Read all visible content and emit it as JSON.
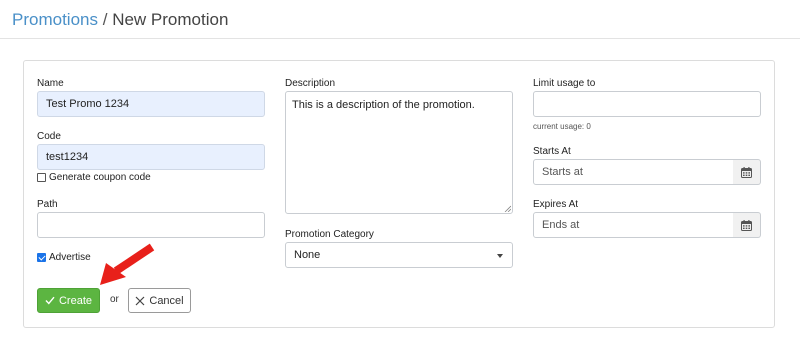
{
  "breadcrumb": {
    "parent": "Promotions",
    "separator": "/",
    "current": "New Promotion"
  },
  "form": {
    "name": {
      "label": "Name",
      "value": "Test Promo 1234"
    },
    "code": {
      "label": "Code",
      "value": "test1234"
    },
    "generate_coupon": {
      "label": "Generate coupon code",
      "checked": false
    },
    "path": {
      "label": "Path",
      "value": ""
    },
    "advertise": {
      "label": "Advertise",
      "checked": true
    },
    "description": {
      "label": "Description",
      "value": "This is a description of the promotion."
    },
    "promotion_category": {
      "label": "Promotion Category",
      "selected": "None"
    },
    "limit_usage": {
      "label": "Limit usage to",
      "value": "",
      "help": "current usage: 0"
    },
    "starts_at": {
      "label": "Starts At",
      "placeholder": "Starts at"
    },
    "expires_at": {
      "label": "Expires At",
      "placeholder": "Ends at"
    }
  },
  "actions": {
    "create_label": "Create",
    "or_text": "or",
    "cancel_label": "Cancel"
  },
  "colors": {
    "create_green": "#5cb541",
    "link_blue": "#4a90c8",
    "autofill_bg": "#e8f0fe",
    "arrow_red": "#e8201a",
    "checkbox_blue": "#1a73e8"
  },
  "icons": {
    "create": "check-icon",
    "cancel": "close-icon",
    "date": "calendar-icon",
    "select": "caret-down-icon",
    "annotation": "red-arrow"
  }
}
